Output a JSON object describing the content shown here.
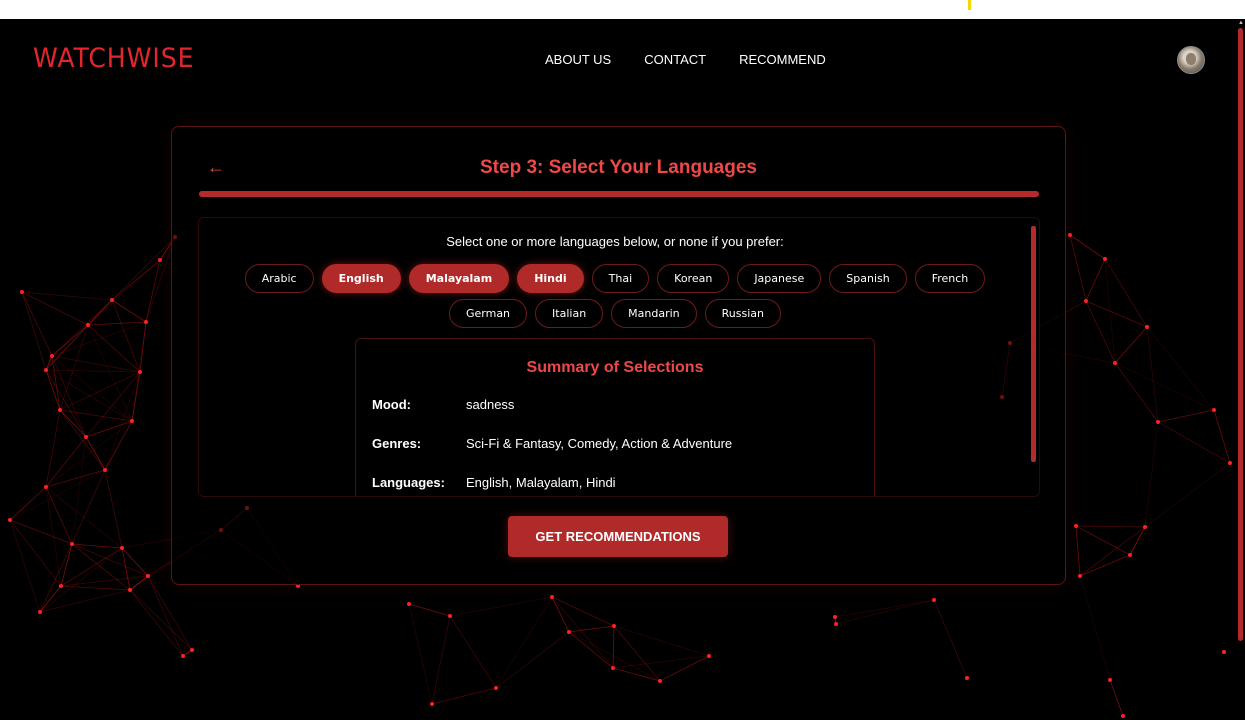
{
  "brand": {
    "name": "WATCHWISE"
  },
  "nav": {
    "links": [
      "ABOUT US",
      "CONTACT",
      "RECOMMEND"
    ]
  },
  "step": {
    "title": "Step 3: Select Your Languages",
    "progress": 1.0,
    "back_icon": "arrow-left-icon"
  },
  "languages": {
    "instruction": "Select one or more languages below, or none if you prefer:",
    "options": [
      {
        "label": "Arabic",
        "selected": false
      },
      {
        "label": "English",
        "selected": true
      },
      {
        "label": "Malayalam",
        "selected": true
      },
      {
        "label": "Hindi",
        "selected": true
      },
      {
        "label": "Thai",
        "selected": false
      },
      {
        "label": "Korean",
        "selected": false
      },
      {
        "label": "Japanese",
        "selected": false
      },
      {
        "label": "Spanish",
        "selected": false
      },
      {
        "label": "French",
        "selected": false
      },
      {
        "label": "German",
        "selected": false
      },
      {
        "label": "Italian",
        "selected": false
      },
      {
        "label": "Mandarin",
        "selected": false
      },
      {
        "label": "Russian",
        "selected": false
      }
    ]
  },
  "summary": {
    "title": "Summary of Selections",
    "mood_label": "Mood:",
    "mood_value": "sadness",
    "genres_label": "Genres:",
    "genres_value": "Sci-Fi & Fantasy, Comedy, Action & Adventure",
    "languages_label": "Languages:",
    "languages_value": "English, Malayalam, Hindi"
  },
  "cta": {
    "label": "GET RECOMMENDATIONS"
  },
  "colors": {
    "accent": "#b02a2a",
    "title_red": "#ef4848",
    "logo_red": "#e3262e",
    "background": "#000000"
  }
}
